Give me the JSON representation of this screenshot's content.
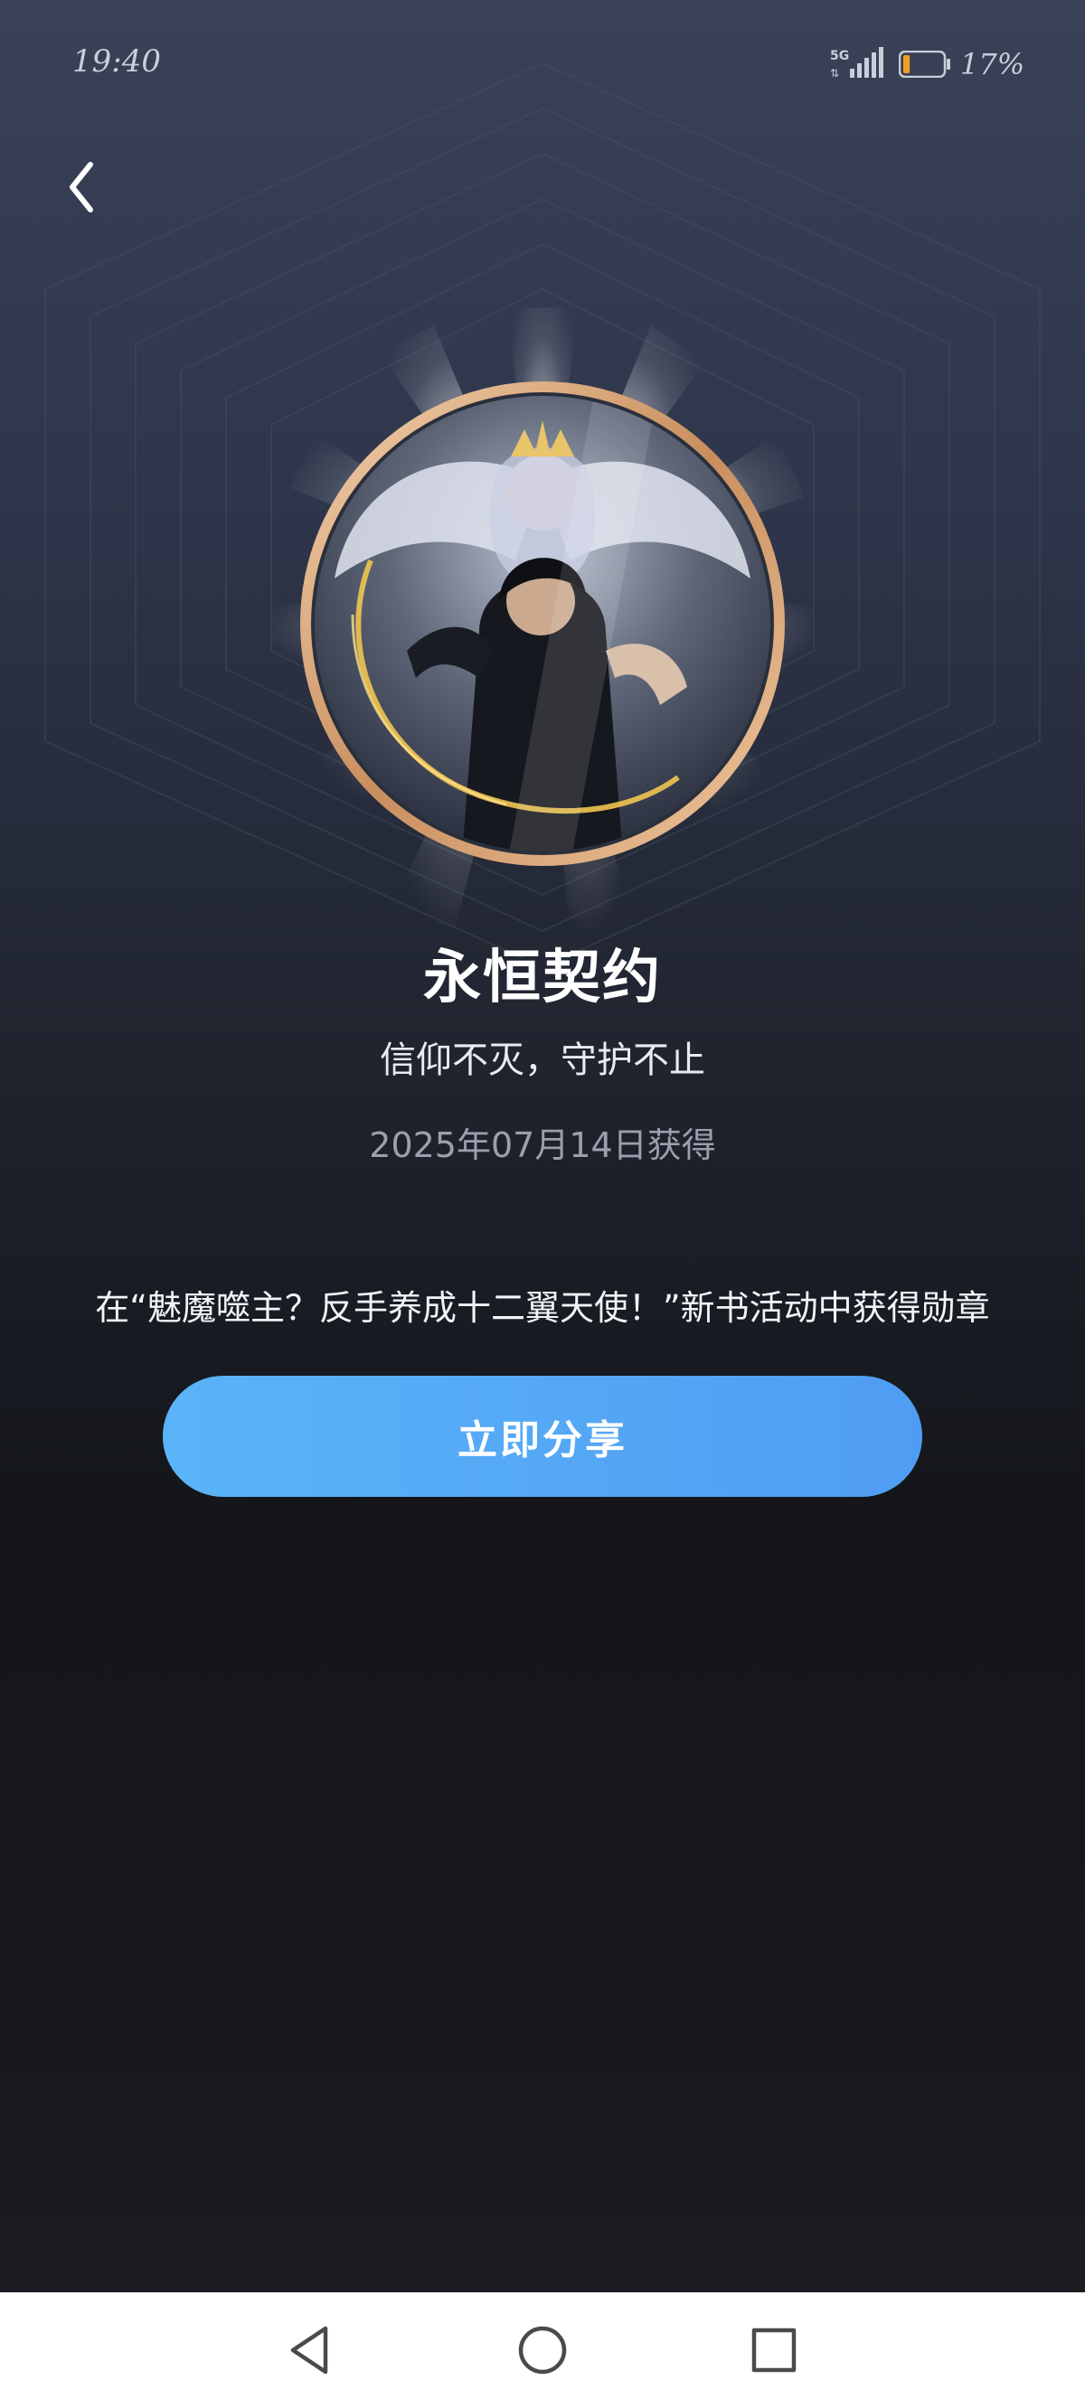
{
  "status_bar": {
    "time": "19:40",
    "network": "5G",
    "battery_percent": "17%",
    "battery_level": 0.17
  },
  "icons": {
    "back": "chevron-left-icon",
    "nav_back": "triangle-back-icon",
    "nav_home": "circle-home-icon",
    "nav_recent": "square-recent-icon"
  },
  "badge": {
    "title": "永恒契约",
    "subtitle": "信仰不灭，守护不止",
    "date": "2025年07月14日获得",
    "description": "在“魅魔噬主？反手养成十二翼天使！”新书活动中获得勋章"
  },
  "actions": {
    "share_label": "立即分享"
  },
  "colors": {
    "accent_start": "#5ab4f7",
    "accent_end": "#4f9df3",
    "badge_ring": "#e2b48a",
    "battery_fill": "#f0a020"
  }
}
